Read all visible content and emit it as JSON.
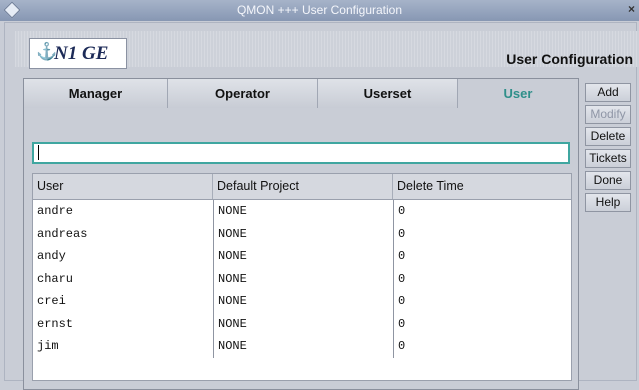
{
  "window": {
    "title": "QMON +++ User Configuration"
  },
  "header": {
    "logo_text": "N1 GE",
    "title": "User Configuration"
  },
  "tabs": [
    {
      "label": "Manager",
      "active": false
    },
    {
      "label": "Operator",
      "active": false
    },
    {
      "label": "Userset",
      "active": false
    },
    {
      "label": "User",
      "active": true
    }
  ],
  "filter": {
    "value": "",
    "placeholder": ""
  },
  "table": {
    "columns": [
      "User",
      "Default Project",
      "Delete Time"
    ],
    "rows": [
      [
        "andre",
        "NONE",
        "0"
      ],
      [
        "andreas",
        "NONE",
        "0"
      ],
      [
        "andy",
        "NONE",
        "0"
      ],
      [
        "charu",
        "NONE",
        "0"
      ],
      [
        "crei",
        "NONE",
        "0"
      ],
      [
        "ernst",
        "NONE",
        "0"
      ],
      [
        "jim",
        "NONE",
        "0"
      ]
    ]
  },
  "buttons": {
    "add": "Add",
    "modify": "Modify",
    "delete": "Delete",
    "tickets": "Tickets",
    "done": "Done",
    "help": "Help"
  },
  "icons": {
    "window_menu": "diamond-icon",
    "close": "close-icon",
    "logo": "n1-logo-icon"
  },
  "colors": {
    "active_tab": "#2f8f8a",
    "titlebar": "#8797b3",
    "filter_border": "#3fa6a0"
  }
}
